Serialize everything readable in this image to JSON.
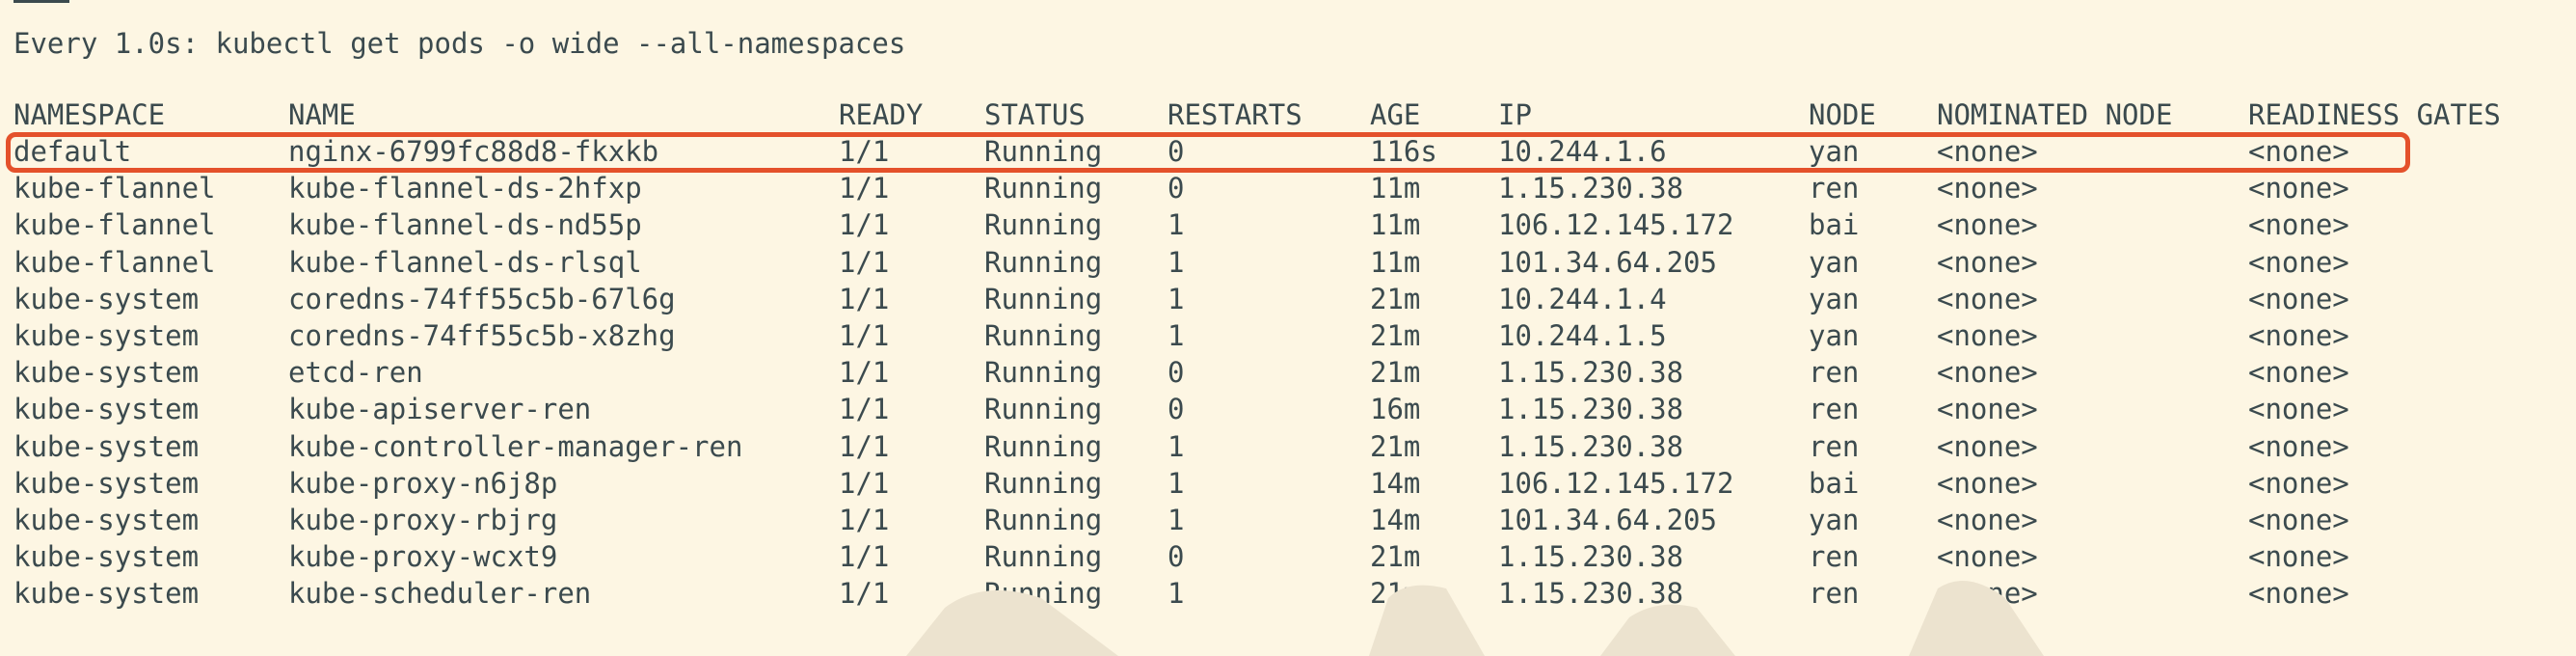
{
  "terminal": {
    "watch_header": "Every 1.0s: kubectl get pods -o wide --all-namespaces",
    "columns": {
      "namespace": "NAMESPACE",
      "name": "NAME",
      "ready": "READY",
      "status": "STATUS",
      "restarts": "RESTARTS",
      "age": "AGE",
      "ip": "IP",
      "node": "NODE",
      "nominated_node": "NOMINATED NODE",
      "readiness_gates": "READINESS GATES"
    },
    "rows": [
      {
        "namespace": "default",
        "name": "nginx-6799fc88d8-fkxkb",
        "ready": "1/1",
        "status": "Running",
        "restarts": "0",
        "age": "116s",
        "ip": "10.244.1.6",
        "node": "yan",
        "nominated_node": "<none>",
        "readiness_gates": "<none>"
      },
      {
        "namespace": "kube-flannel",
        "name": "kube-flannel-ds-2hfxp",
        "ready": "1/1",
        "status": "Running",
        "restarts": "0",
        "age": "11m",
        "ip": "1.15.230.38",
        "node": "ren",
        "nominated_node": "<none>",
        "readiness_gates": "<none>"
      },
      {
        "namespace": "kube-flannel",
        "name": "kube-flannel-ds-nd55p",
        "ready": "1/1",
        "status": "Running",
        "restarts": "1",
        "age": "11m",
        "ip": "106.12.145.172",
        "node": "bai",
        "nominated_node": "<none>",
        "readiness_gates": "<none>"
      },
      {
        "namespace": "kube-flannel",
        "name": "kube-flannel-ds-rlsql",
        "ready": "1/1",
        "status": "Running",
        "restarts": "1",
        "age": "11m",
        "ip": "101.34.64.205",
        "node": "yan",
        "nominated_node": "<none>",
        "readiness_gates": "<none>"
      },
      {
        "namespace": "kube-system",
        "name": "coredns-74ff55c5b-67l6g",
        "ready": "1/1",
        "status": "Running",
        "restarts": "1",
        "age": "21m",
        "ip": "10.244.1.4",
        "node": "yan",
        "nominated_node": "<none>",
        "readiness_gates": "<none>"
      },
      {
        "namespace": "kube-system",
        "name": "coredns-74ff55c5b-x8zhg",
        "ready": "1/1",
        "status": "Running",
        "restarts": "1",
        "age": "21m",
        "ip": "10.244.1.5",
        "node": "yan",
        "nominated_node": "<none>",
        "readiness_gates": "<none>"
      },
      {
        "namespace": "kube-system",
        "name": "etcd-ren",
        "ready": "1/1",
        "status": "Running",
        "restarts": "0",
        "age": "21m",
        "ip": "1.15.230.38",
        "node": "ren",
        "nominated_node": "<none>",
        "readiness_gates": "<none>"
      },
      {
        "namespace": "kube-system",
        "name": "kube-apiserver-ren",
        "ready": "1/1",
        "status": "Running",
        "restarts": "0",
        "age": "16m",
        "ip": "1.15.230.38",
        "node": "ren",
        "nominated_node": "<none>",
        "readiness_gates": "<none>"
      },
      {
        "namespace": "kube-system",
        "name": "kube-controller-manager-ren",
        "ready": "1/1",
        "status": "Running",
        "restarts": "1",
        "age": "21m",
        "ip": "1.15.230.38",
        "node": "ren",
        "nominated_node": "<none>",
        "readiness_gates": "<none>"
      },
      {
        "namespace": "kube-system",
        "name": "kube-proxy-n6j8p",
        "ready": "1/1",
        "status": "Running",
        "restarts": "1",
        "age": "14m",
        "ip": "106.12.145.172",
        "node": "bai",
        "nominated_node": "<none>",
        "readiness_gates": "<none>"
      },
      {
        "namespace": "kube-system",
        "name": "kube-proxy-rbjrg",
        "ready": "1/1",
        "status": "Running",
        "restarts": "1",
        "age": "14m",
        "ip": "101.34.64.205",
        "node": "yan",
        "nominated_node": "<none>",
        "readiness_gates": "<none>"
      },
      {
        "namespace": "kube-system",
        "name": "kube-proxy-wcxt9",
        "ready": "1/1",
        "status": "Running",
        "restarts": "0",
        "age": "21m",
        "ip": "1.15.230.38",
        "node": "ren",
        "nominated_node": "<none>",
        "readiness_gates": "<none>"
      },
      {
        "namespace": "kube-system",
        "name": "kube-scheduler-ren",
        "ready": "1/1",
        "status": "Running",
        "restarts": "1",
        "age": "21m",
        "ip": "1.15.230.38",
        "node": "ren",
        "nominated_node": "<none>",
        "readiness_gates": "<none>"
      }
    ]
  },
  "theme": {
    "background": "#fdf6e3",
    "text": "#3b4a4e",
    "highlight": "#e4512b"
  }
}
